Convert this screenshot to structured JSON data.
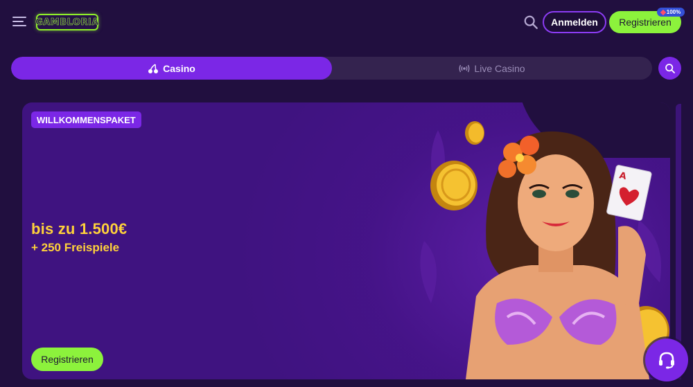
{
  "header": {
    "menu_icon": "hamburger-menu-icon",
    "logo_text": "GAMBLORIA",
    "search_icon": "search-icon",
    "login_label": "Anmelden",
    "register_label": "Registrieren",
    "register_badge": "100%"
  },
  "tabs": [
    {
      "label": "Casino",
      "icon": "cherries-icon",
      "active": true
    },
    {
      "label": "Live Casino",
      "icon": "broadcast-icon",
      "active": false
    }
  ],
  "banner": {
    "badge": "WILLKOMMENSPAKET",
    "amount": "bis zu 1.500€",
    "spins": "+ 250 Freispiele",
    "cta_label": "Registrieren"
  },
  "support": {
    "icon": "headset-icon"
  },
  "colors": {
    "background": "#210f3f",
    "accent_purple": "#7b27e6",
    "accent_green": "#8cf23c",
    "offer_yellow": "#ffd23a",
    "badge_blue": "#3451d8"
  }
}
